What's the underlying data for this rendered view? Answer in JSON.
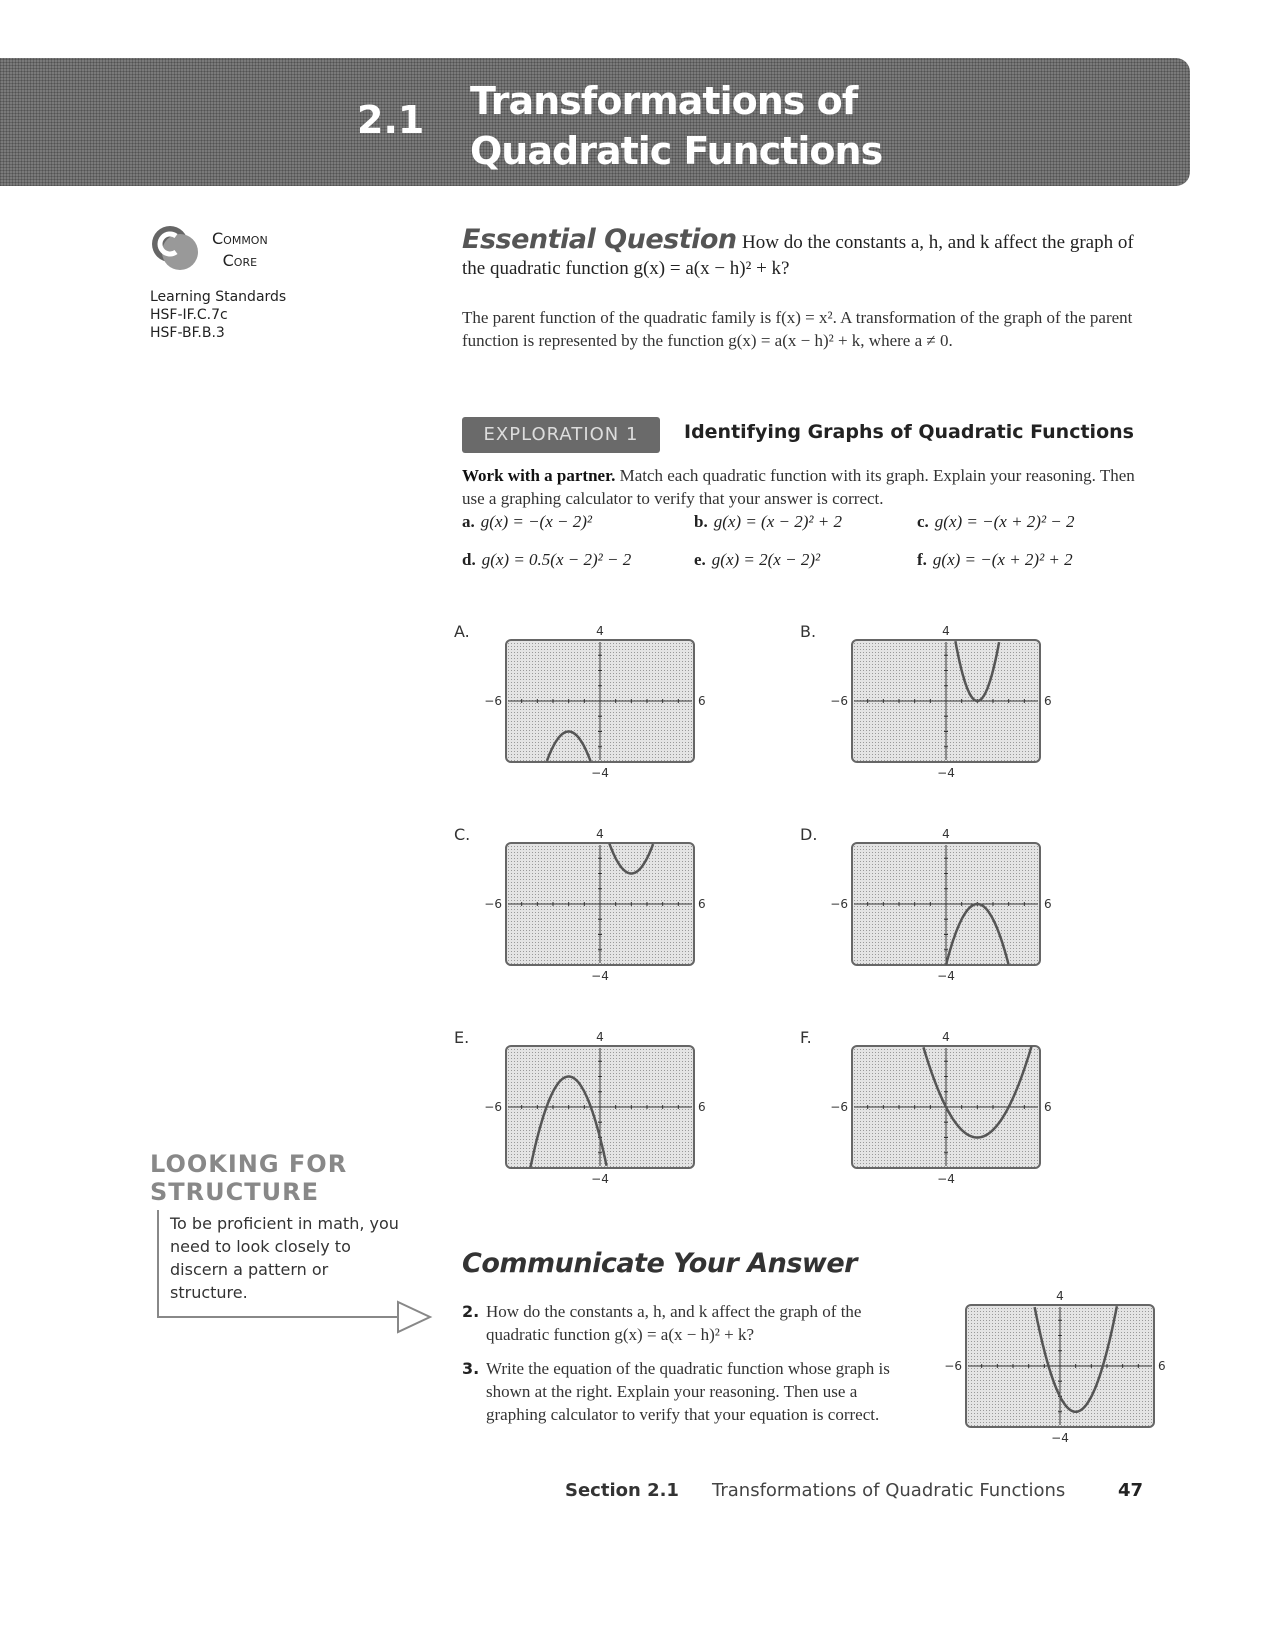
{
  "header": {
    "section_number": "2.1",
    "title_line1": "Transformations of",
    "title_line2": "Quadratic Functions"
  },
  "sidebar": {
    "logo_line1": "Common",
    "logo_line2": "Core",
    "standards_label": "Learning Standards",
    "standards": [
      "HSF-IF.C.7c",
      "HSF-BF.B.3"
    ],
    "tip": {
      "title_line1": "LOOKING FOR",
      "title_line2": "STRUCTURE",
      "body": "To be proficient in math, you need to look closely to discern a pattern or structure."
    }
  },
  "essential_question": {
    "heading": "Essential Question",
    "text": "How do the constants a, h, and k affect the graph of the quadratic function g(x) = a(x − h)² + k?"
  },
  "intro": "The parent function of the quadratic family is f(x) = x². A transformation of the graph of the parent function is represented by the function g(x) = a(x − h)² + k, where a ≠ 0.",
  "exploration": {
    "badge": "EXPLORATION 1",
    "title": "Identifying Graphs of Quadratic Functions",
    "lead": "Work with a partner.",
    "instructions": "Match each quadratic function with its graph. Explain your reasoning. Then use a graphing calculator to verify that your answer is correct.",
    "functions": [
      {
        "label": "a.",
        "expr": "g(x) = −(x − 2)²"
      },
      {
        "label": "b.",
        "expr": "g(x) = (x − 2)² + 2"
      },
      {
        "label": "c.",
        "expr": "g(x) = −(x + 2)² − 2"
      },
      {
        "label": "d.",
        "expr": "g(x) = 0.5(x − 2)² − 2"
      },
      {
        "label": "e.",
        "expr": "g(x) = 2(x − 2)²"
      },
      {
        "label": "f.",
        "expr": "g(x) = −(x + 2)² + 2"
      }
    ]
  },
  "chart_data": [
    {
      "type": "line",
      "title": "A.",
      "xlim": [
        -6,
        6
      ],
      "ylim": [
        -4,
        4
      ],
      "tick_labels": {
        "top": "4",
        "bottom": "−4",
        "left": "−6",
        "right": "6"
      },
      "series": [
        {
          "name": "g",
          "a": -1,
          "h": -2,
          "k": -2
        }
      ]
    },
    {
      "type": "line",
      "title": "B.",
      "xlim": [
        -6,
        6
      ],
      "ylim": [
        -4,
        4
      ],
      "tick_labels": {
        "top": "4",
        "bottom": "−4",
        "left": "−6",
        "right": "6"
      },
      "series": [
        {
          "name": "g",
          "a": 2,
          "h": 2,
          "k": 0
        }
      ]
    },
    {
      "type": "line",
      "title": "C.",
      "xlim": [
        -6,
        6
      ],
      "ylim": [
        -4,
        4
      ],
      "tick_labels": {
        "top": "4",
        "bottom": "−4",
        "left": "−6",
        "right": "6"
      },
      "series": [
        {
          "name": "g",
          "a": 1,
          "h": 2,
          "k": 2
        }
      ]
    },
    {
      "type": "line",
      "title": "D.",
      "xlim": [
        -6,
        6
      ],
      "ylim": [
        -4,
        4
      ],
      "tick_labels": {
        "top": "4",
        "bottom": "−4",
        "left": "−6",
        "right": "6"
      },
      "series": [
        {
          "name": "g",
          "a": -1,
          "h": 2,
          "k": 0
        }
      ]
    },
    {
      "type": "line",
      "title": "E.",
      "xlim": [
        -6,
        6
      ],
      "ylim": [
        -4,
        4
      ],
      "tick_labels": {
        "top": "4",
        "bottom": "−4",
        "left": "−6",
        "right": "6"
      },
      "series": [
        {
          "name": "g",
          "a": -1,
          "h": -2,
          "k": 2
        }
      ]
    },
    {
      "type": "line",
      "title": "F.",
      "xlim": [
        -6,
        6
      ],
      "ylim": [
        -4,
        4
      ],
      "tick_labels": {
        "top": "4",
        "bottom": "−4",
        "left": "−6",
        "right": "6"
      },
      "series": [
        {
          "name": "g",
          "a": 0.5,
          "h": 2,
          "k": -2
        }
      ]
    },
    {
      "type": "line",
      "title": "",
      "xlim": [
        -6,
        6
      ],
      "ylim": [
        -4,
        4
      ],
      "tick_labels": {
        "top": "4",
        "bottom": "−4",
        "left": "−6",
        "right": "6"
      },
      "series": [
        {
          "name": "g",
          "a": 1,
          "h": 1,
          "k": -3
        }
      ]
    }
  ],
  "communicate": {
    "heading": "Communicate Your Answer",
    "questions": [
      {
        "number": "2.",
        "text": "How do the constants a, h, and k affect the graph of the quadratic function g(x) = a(x − h)² + k?"
      },
      {
        "number": "3.",
        "text": "Write the equation of the quadratic function whose graph is shown at the right. Explain your reasoning. Then use a graphing calculator to verify that your equation is correct."
      }
    ]
  },
  "footer": {
    "section": "Section 2.1",
    "title": "Transformations of Quadratic Functions",
    "page": "47"
  }
}
